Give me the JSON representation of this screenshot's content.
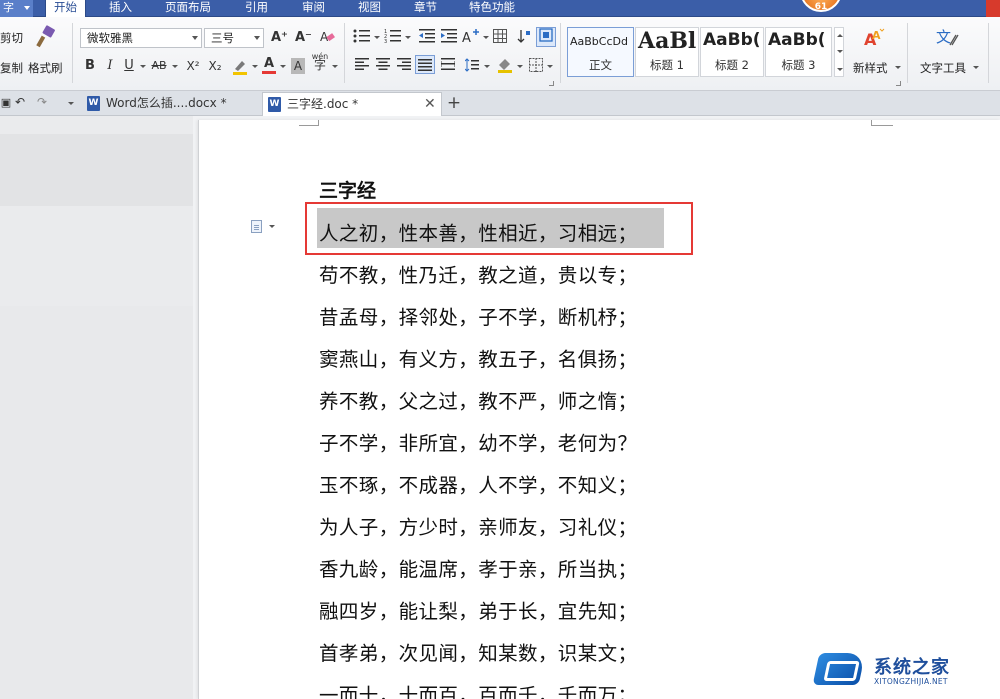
{
  "app_button": "字",
  "menus": [
    "开始",
    "插入",
    "页面布局",
    "引用",
    "审阅",
    "视图",
    "章节",
    "特色功能"
  ],
  "badge_value": "61",
  "clipboard": {
    "cut": "剪切",
    "copy": "复制",
    "format_painter": "格式刷"
  },
  "font": {
    "name": "微软雅黑",
    "size": "三号"
  },
  "format_buttons": {
    "bold": "B",
    "italic": "I",
    "underline": "U",
    "strike": "AB",
    "superscript": "X²",
    "subscript": "X₂",
    "font_color": "A",
    "char_shading": "A",
    "grow": "A⁺",
    "shrink": "A⁻",
    "phonetic": "wén"
  },
  "styles": [
    {
      "preview": "AaBbCcDd",
      "label": "正文"
    },
    {
      "preview": "AaBl",
      "label": "标题 1"
    },
    {
      "preview": "AaBb(",
      "label": "标题 2"
    },
    {
      "preview": "AaBb(",
      "label": "标题 3"
    }
  ],
  "new_style": "新样式",
  "text_tools": "文字工具",
  "tabs": [
    {
      "label": "Word怎么插....docx *"
    },
    {
      "label": "三字经.doc *"
    }
  ],
  "new_tab": "+",
  "document": {
    "title": "三字经",
    "lines": [
      "人之初，性本善，性相近，习相远；",
      "苟不教，性乃迁，教之道，贵以专；",
      "昔孟母，择邻处，子不学，断机杼；",
      "窦燕山，有义方，教五子，名俱扬；",
      "养不教，父之过，教不严，师之惰；",
      "子不学，非所宜，幼不学，老何为？",
      "玉不琢，不成器，人不学，不知义；",
      "为人子，方少时，亲师友，习礼仪；",
      "香九龄，能温席，孝于亲，所当执；",
      "融四岁，能让梨，弟于长，宜先知；",
      "首孝弟，次见闻，知某数，识某文；",
      "一而十，十而百，百而千，千而万；"
    ]
  },
  "watermark": {
    "cn": "系统之家",
    "en": "XITONGZHIJIA.NET"
  },
  "colors": {
    "menubar": "#3b5ea8",
    "selection_border": "#e53935",
    "highlight": "#c8c8c8"
  }
}
